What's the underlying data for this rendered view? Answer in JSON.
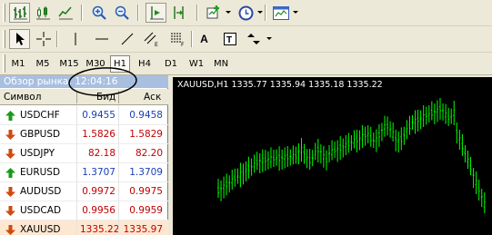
{
  "toolbar_main": {
    "icons": [
      "bar-chart-icon",
      "candlestick-chart-icon",
      "line-chart-icon",
      "zoom-in-icon",
      "zoom-out-icon",
      "autoscroll-icon",
      "chart-shift-icon",
      "indicators-icon",
      "periodicity-clock-icon",
      "templates-icon"
    ]
  },
  "toolbar_draw": {
    "icons": [
      "cursor-arrow-icon",
      "crosshair-icon",
      "vertical-line-icon",
      "horizontal-line-icon",
      "trend-line-icon",
      "equidistant-channel-icon",
      "fibonacci-retracement-icon",
      "text-label-icon",
      "text-label-box-icon",
      "arrows-icon"
    ],
    "text_tool_glyph": "A"
  },
  "timeframes": {
    "items": [
      "M1",
      "M5",
      "M15",
      "M30",
      "H1",
      "H4",
      "D1",
      "W1",
      "MN"
    ],
    "active": "H1"
  },
  "market_watch": {
    "title": "Обзор рынка: 12:04:16",
    "col_symbol": "Символ",
    "col_bid": "Бид",
    "col_ask": "Аск",
    "rows": [
      {
        "symbol": "USDCHF",
        "bid": "0.9455",
        "ask": "0.9458",
        "dir": "up"
      },
      {
        "symbol": "GBPUSD",
        "bid": "1.5826",
        "ask": "1.5829",
        "dir": "down"
      },
      {
        "symbol": "USDJPY",
        "bid": "82.18",
        "ask": "82.20",
        "dir": "down"
      },
      {
        "symbol": "EURUSD",
        "bid": "1.3707",
        "ask": "1.3709",
        "dir": "up"
      },
      {
        "symbol": "AUDUSD",
        "bid": "0.9972",
        "ask": "0.9975",
        "dir": "down"
      },
      {
        "symbol": "USDCAD",
        "bid": "0.9956",
        "ask": "0.9959",
        "dir": "down"
      },
      {
        "symbol": "XAUUSD",
        "bid": "1335.22",
        "ask": "1335.97",
        "dir": "down"
      }
    ],
    "selected_symbol": "XAUUSD"
  },
  "chart": {
    "label": "XAUUSD,H1  1335.77 1335.94 1335.18 1335.22",
    "bar_color": "#00ff00",
    "background": "#000000"
  },
  "colors": {
    "bid_up": "#1a3dbb",
    "bid_down": "#c00000",
    "arrow_up": "#1a9a1a",
    "arrow_down": "#d04a10"
  }
}
